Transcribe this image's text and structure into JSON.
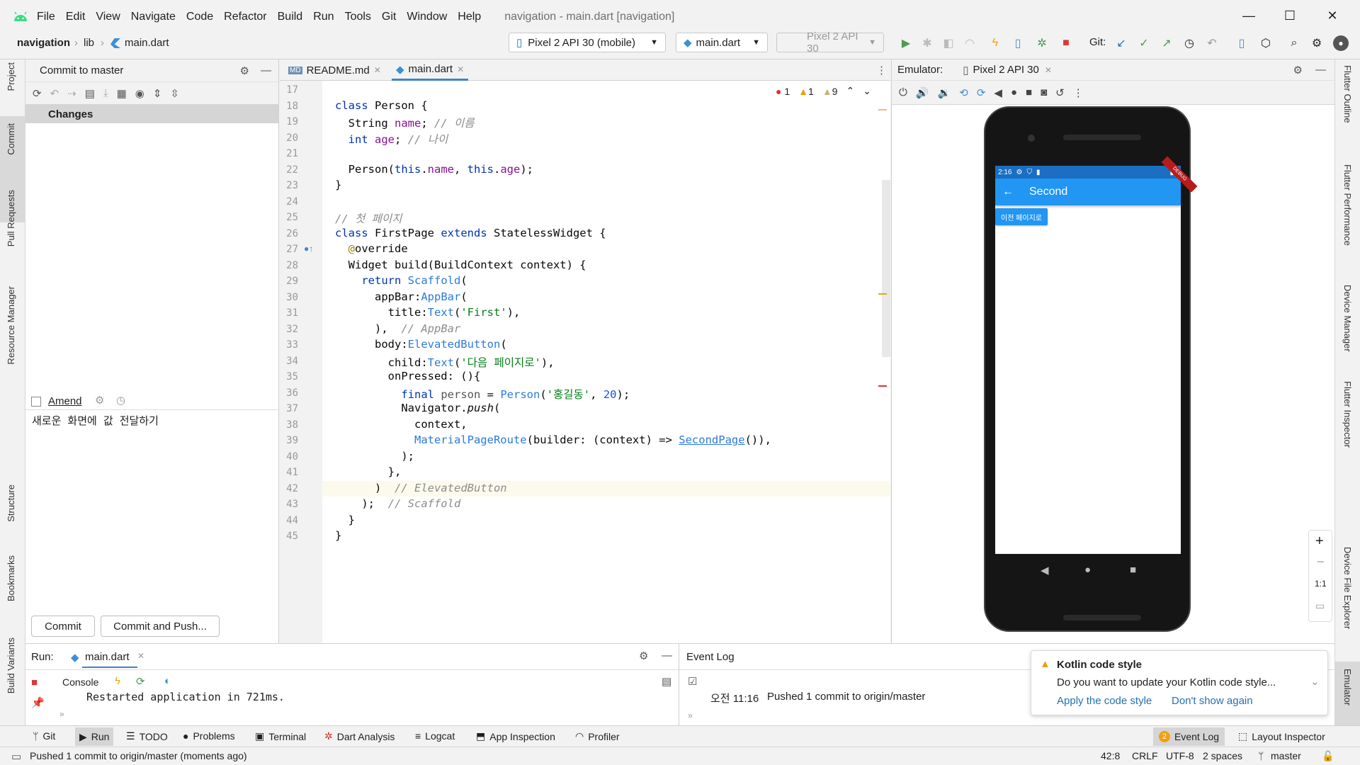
{
  "menu": {
    "items": [
      "File",
      "Edit",
      "View",
      "Navigate",
      "Code",
      "Refactor",
      "Build",
      "Run",
      "Tools",
      "Git",
      "Window",
      "Help"
    ],
    "window_title": "navigation - main.dart [navigation]"
  },
  "nav": {
    "project": "navigation",
    "folder": "lib",
    "file": "main.dart",
    "device_select": "Pixel 2 API 30 (mobile)",
    "run_config": "main.dart",
    "emulator_select": "Pixel 2 API 30",
    "git_label": "Git:"
  },
  "left_stripe": [
    "Project",
    "Commit",
    "Pull Requests",
    "Resource Manager",
    "Structure",
    "Bookmarks",
    "Build Variants"
  ],
  "right_stripe": [
    "Flutter Outline",
    "Flutter Performance",
    "Device Manager",
    "Flutter Inspector",
    "Device File Explorer",
    "Emulator"
  ],
  "commit_panel": {
    "title": "Commit to master",
    "changes_label": "Changes",
    "amend_label": "Amend",
    "message": "새로운 화면에 값 전달하기",
    "commit_btn": "Commit",
    "commit_push_btn": "Commit and Push..."
  },
  "editor": {
    "tabs": [
      "README.md",
      "main.dart"
    ],
    "inspections": {
      "errors": "1",
      "warnings": "1",
      "weak": "9"
    }
  },
  "code_lines": [
    {
      "n": "17",
      "html": ""
    },
    {
      "n": "18",
      "html": "<span class='kw'>class</span> Person {"
    },
    {
      "n": "19",
      "html": "  String <span class='fd'>name</span>; <span class='cm'>// 이름</span>"
    },
    {
      "n": "20",
      "html": "  <span class='kw'>int</span> <span class='fd'>age</span>; <span class='cm'>// 나이</span>"
    },
    {
      "n": "21",
      "html": ""
    },
    {
      "n": "22",
      "html": "  Person(<span class='kw'>this</span>.<span class='fd'>name</span>, <span class='kw'>this</span>.<span class='fd'>age</span>);"
    },
    {
      "n": "23",
      "html": "}"
    },
    {
      "n": "24",
      "html": ""
    },
    {
      "n": "25",
      "html": "<span class='cm'>// 첫 페이지</span>"
    },
    {
      "n": "26",
      "html": "<span class='kw'>class</span> FirstPage <span class='kw'>extends</span> StatelessWidget {"
    },
    {
      "n": "27",
      "html": "  <span class='an'>@</span>override"
    },
    {
      "n": "28",
      "html": "  Widget build(BuildContext context) {"
    },
    {
      "n": "29",
      "html": "    <span class='kw'>return</span> <span class='cl'>Scaffold</span>("
    },
    {
      "n": "30",
      "html": "      appBar:<span class='cl'>AppBar</span>("
    },
    {
      "n": "31",
      "html": "        title:<span class='cl'>Text</span>(<span class='st'>'First'</span>),"
    },
    {
      "n": "32",
      "html": "      ),  <span class='cm'>// AppBar</span>"
    },
    {
      "n": "33",
      "html": "      body:<span class='cl'>ElevatedButton</span>("
    },
    {
      "n": "34",
      "html": "        child:<span class='cl'>Text</span>(<span class='st'>'다음 페이지로'</span>),"
    },
    {
      "n": "35",
      "html": "        onPressed: (){"
    },
    {
      "n": "36",
      "html": "          <span class='kw'>final</span> <span style='color:#555'>person</span> = <span class='cl'>Person</span>(<span class='st'>'홍길동'</span>, <span class='nm'>20</span>);"
    },
    {
      "n": "37",
      "html": "          Navigator.<i>push</i>("
    },
    {
      "n": "38",
      "html": "            context,"
    },
    {
      "n": "39",
      "html": "            <span class='cl'>MaterialPageRoute</span>(builder: (context) => <span class='cl' style='text-decoration:underline'>SecondPage</span>()),"
    },
    {
      "n": "40",
      "html": "          );"
    },
    {
      "n": "41",
      "html": "        },"
    },
    {
      "n": "42",
      "html": "      )  <span class='cm'>// ElevatedButton</span>"
    },
    {
      "n": "43",
      "html": "    );  <span class='cm'>// Scaffold</span>"
    },
    {
      "n": "44",
      "html": "  }"
    },
    {
      "n": "45",
      "html": "}"
    }
  ],
  "emulator": {
    "label": "Emulator:",
    "device_tab": "Pixel 2 API 30",
    "phone": {
      "time": "2:16",
      "appbar_title": "Second",
      "button": "이전 페이지로",
      "debug_banner": "DEBUG"
    }
  },
  "run_panel": {
    "label": "Run:",
    "tab": "main.dart",
    "console_tab": "Console",
    "output": "Restarted application in 721ms."
  },
  "event_log": {
    "title": "Event Log",
    "time": "오전 11:16",
    "message": "Pushed 1 commit to origin/master"
  },
  "notification": {
    "title": "Kotlin code style",
    "body": "Do you want to update your Kotlin code style...",
    "action1": "Apply the code style",
    "action2": "Don't show again"
  },
  "bottom_tools": [
    "Git",
    "Run",
    "TODO",
    "Problems",
    "Terminal",
    "Dart Analysis",
    "Logcat",
    "App Inspection",
    "Profiler"
  ],
  "bottom_right": {
    "event_log": "Event Log",
    "event_count": "2",
    "layout_inspector": "Layout Inspector"
  },
  "status": {
    "message": "Pushed 1 commit to origin/master (moments ago)",
    "position": "42:8",
    "line_sep": "CRLF",
    "encoding": "UTF-8",
    "indent": "2 spaces",
    "branch": "master"
  }
}
